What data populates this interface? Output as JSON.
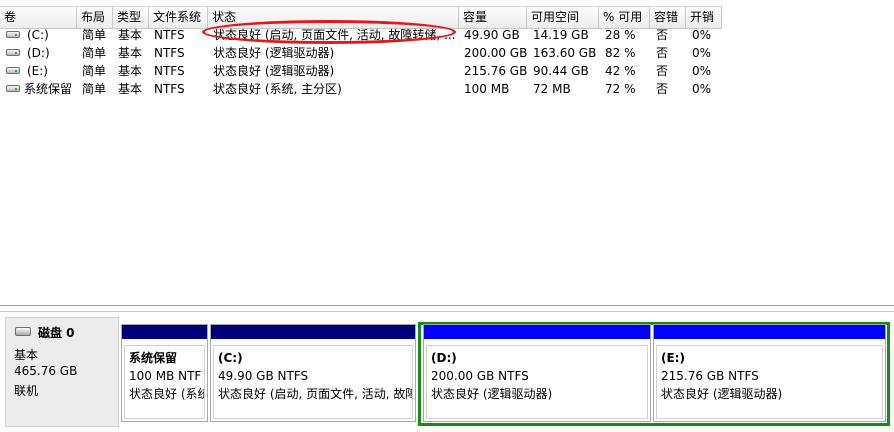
{
  "columns": [
    "卷",
    "布局",
    "类型",
    "文件系统",
    "状态",
    "容量",
    "可用空间",
    "% 可用",
    "容错",
    "开销"
  ],
  "volumes": [
    {
      "name": "(C:)",
      "layout": "简单",
      "type": "基本",
      "fs": "NTFS",
      "status": "状态良好 (启动, 页面文件, 活动, 故障转储, ...",
      "capacity": "49.90 GB",
      "free": "14.19 GB",
      "pct": "28 %",
      "fault": "否",
      "overhead": "0%"
    },
    {
      "name": "(D:)",
      "layout": "简单",
      "type": "基本",
      "fs": "NTFS",
      "status": "状态良好 (逻辑驱动器)",
      "capacity": "200.00 GB",
      "free": "163.60 GB",
      "pct": "82 %",
      "fault": "否",
      "overhead": "0%"
    },
    {
      "name": "(E:)",
      "layout": "简单",
      "type": "基本",
      "fs": "NTFS",
      "status": "状态良好 (逻辑驱动器)",
      "capacity": "215.76 GB",
      "free": "90.44 GB",
      "pct": "42 %",
      "fault": "否",
      "overhead": "0%"
    },
    {
      "name": "系统保留",
      "layout": "简单",
      "type": "基本",
      "fs": "NTFS",
      "status": "状态良好 (系统, 主分区)",
      "capacity": "100 MB",
      "free": "72 MB",
      "pct": "72 %",
      "fault": "否",
      "overhead": "0%"
    }
  ],
  "disk": {
    "name": "磁盘 0",
    "type": "基本",
    "size": "465.76 GB",
    "state": "联机"
  },
  "partitions": [
    {
      "title": "系统保留",
      "size": "100 MB NTF",
      "status": "状态良好 (系统"
    },
    {
      "title": "(C:)",
      "size": "49.90 GB NTFS",
      "status": "状态良好 (启动, 页面文件, 活动, 故障"
    },
    {
      "title": "(D:)",
      "size": "200.00 GB NTFS",
      "status": "状态良好 (逻辑驱动器)"
    },
    {
      "title": "(E:)",
      "size": "215.76 GB NTFS",
      "status": "状态良好 (逻辑驱动器)"
    }
  ],
  "colors": {
    "primary_partition_bar": "#00007b",
    "logical_drive_bar": "#0000ff",
    "extended_partition_frame": "#138f13",
    "annotation_ellipse": "#e3171c"
  }
}
